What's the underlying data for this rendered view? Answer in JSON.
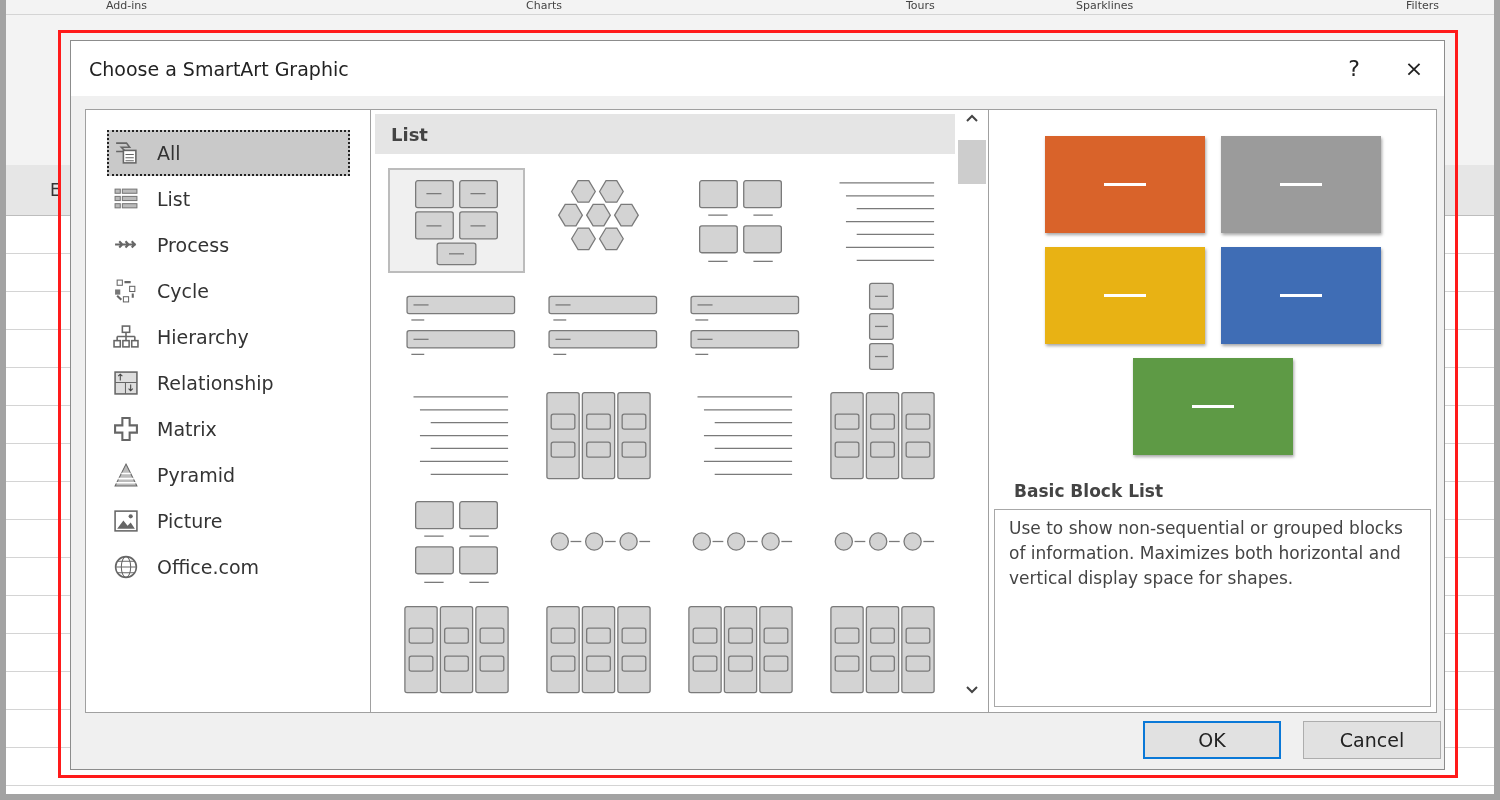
{
  "sheet": {
    "ribbon_groups": [
      "Add-ins",
      "Charts",
      "Tours",
      "Sparklines",
      "Filters"
    ],
    "column_header": "E"
  },
  "dialog": {
    "title": "Choose a SmartArt Graphic",
    "help": "?",
    "close": "×",
    "categories": [
      {
        "label": "All",
        "kind": "all",
        "selected": true
      },
      {
        "label": "List",
        "kind": "list",
        "selected": false
      },
      {
        "label": "Process",
        "kind": "process",
        "selected": false
      },
      {
        "label": "Cycle",
        "kind": "cycle",
        "selected": false
      },
      {
        "label": "Hierarchy",
        "kind": "hierarchy",
        "selected": false
      },
      {
        "label": "Relationship",
        "kind": "relationship",
        "selected": false
      },
      {
        "label": "Matrix",
        "kind": "matrix",
        "selected": false
      },
      {
        "label": "Pyramid",
        "kind": "pyramid",
        "selected": false
      },
      {
        "label": "Picture",
        "kind": "picture",
        "selected": false
      },
      {
        "label": "Office.com",
        "kind": "web",
        "selected": false
      }
    ],
    "gallery": {
      "section": "List",
      "layouts": [
        {
          "kind": "grid",
          "selected": true
        },
        {
          "kind": "hex",
          "selected": false
        },
        {
          "kind": "grid4",
          "selected": false
        },
        {
          "kind": "lines",
          "selected": false
        },
        {
          "kind": "bars",
          "selected": false
        },
        {
          "kind": "bars",
          "selected": false
        },
        {
          "kind": "bars",
          "selected": false
        },
        {
          "kind": "stack",
          "selected": false
        },
        {
          "kind": "lines",
          "selected": false
        },
        {
          "kind": "columns",
          "selected": false
        },
        {
          "kind": "lines",
          "selected": false
        },
        {
          "kind": "columns",
          "selected": false
        },
        {
          "kind": "grid4",
          "selected": false
        },
        {
          "kind": "circles",
          "selected": false
        },
        {
          "kind": "circles",
          "selected": false
        },
        {
          "kind": "circles",
          "selected": false
        },
        {
          "kind": "columns",
          "selected": false
        },
        {
          "kind": "columns",
          "selected": false
        },
        {
          "kind": "columns",
          "selected": false
        },
        {
          "kind": "columns",
          "selected": false
        }
      ]
    },
    "preview": {
      "blocks": [
        {
          "color": "#d9632a"
        },
        {
          "color": "#9b9b9b"
        },
        {
          "color": "#e8b214"
        },
        {
          "color": "#3f6db5"
        },
        {
          "color": "#5e9a45"
        }
      ],
      "name": "Basic Block List",
      "description": "Use to show non-sequential or grouped blocks of information. Maximizes both horizontal and vertical display space for shapes."
    },
    "buttons": [
      {
        "label": "OK",
        "default": true
      },
      {
        "label": "Cancel",
        "default": false
      }
    ]
  }
}
